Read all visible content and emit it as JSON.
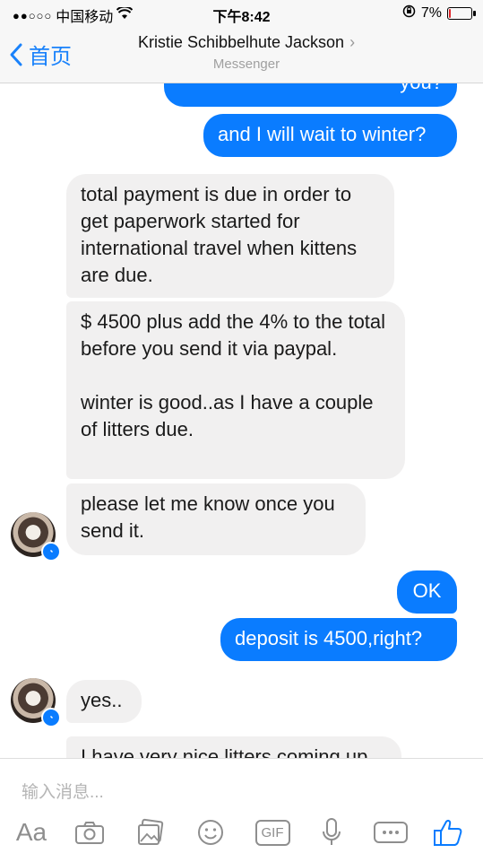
{
  "status_bar": {
    "signal": "●●○○○",
    "carrier": "中国移动",
    "time": "下午8:42",
    "battery_pct": "7%",
    "battery_level": 0.07
  },
  "nav": {
    "back_label": "首页",
    "contact_name": "Kristie Schibbelhute Jackson",
    "subtitle": "Messenger"
  },
  "messages": [
    {
      "id": "m0",
      "side": "out",
      "text": "you?"
    },
    {
      "id": "m1",
      "side": "out",
      "text": "and I will wait to winter?"
    },
    {
      "id": "m2",
      "side": "in",
      "text": "total payment is due in order to get paperwork started for international travel when kittens are due."
    },
    {
      "id": "m3",
      "side": "in",
      "text": "$ 4500 plus add the 4% to the total before you send it via paypal.\n\nwinter is good..as I have a couple of litters due."
    },
    {
      "id": "m4",
      "side": "in",
      "text": "please let me know once you send it."
    },
    {
      "id": "m5",
      "side": "out",
      "text": "OK"
    },
    {
      "id": "m6",
      "side": "out",
      "text": "deposit is 4500,right?"
    },
    {
      "id": "m7",
      "side": "in",
      "text": "yes.."
    },
    {
      "id": "m8",
      "side": "in",
      "text": "I have very nice litters coming up"
    }
  ],
  "composer": {
    "placeholder": "输入消息...",
    "toolbar": {
      "text_label": "Aa",
      "gif_label": "GIF",
      "icons": [
        "text-format-icon",
        "camera-icon",
        "photo-gallery-icon",
        "emoji-icon",
        "gif-icon",
        "microphone-icon",
        "more-icon",
        "like-icon"
      ]
    }
  },
  "colors": {
    "accent": "#0a7cff",
    "incoming_bubble": "#f1f0f0",
    "nav_back": "#1a82fb",
    "battery_low": "#e0262b"
  }
}
